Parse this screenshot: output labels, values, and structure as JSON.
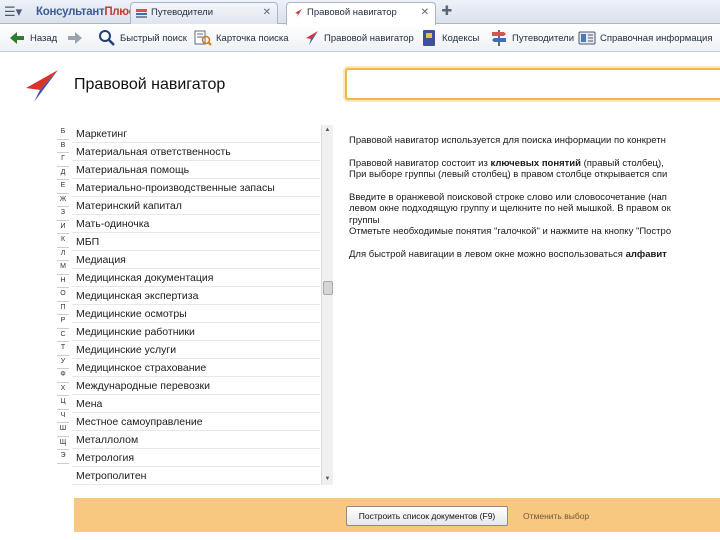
{
  "app": {
    "logo_main": "Консультант",
    "logo_accent": "Плюс"
  },
  "tabs": [
    {
      "label": "Путеводители"
    },
    {
      "label": "Правовой навигатор"
    }
  ],
  "toolbar": {
    "back": "Назад",
    "quick_search": "Быстрый поиск",
    "search_card": "Карточка поиска",
    "legal_navigator": "Правовой навигатор",
    "codes": "Кодексы",
    "guides": "Путеводители",
    "reference": "Справочная информация"
  },
  "page": {
    "title": "Правовой навигатор",
    "search_value": ""
  },
  "alphabet": [
    "Б",
    "В",
    "Г",
    "Д",
    "Е",
    "Ж",
    "З",
    "И",
    "К",
    "Л",
    "М",
    "Н",
    "О",
    "П",
    "Р",
    "С",
    "Т",
    "У",
    "Ф",
    "Х",
    "Ц",
    "Ч",
    "Ш",
    "Щ",
    "Э"
  ],
  "concepts": [
    "Маркетинг",
    "Материальная ответственность",
    "Материальная помощь",
    "Материально-производственные запасы",
    "Материнский капитал",
    "Мать-одиночка",
    "МБП",
    "Медиация",
    "Медицинская документация",
    "Медицинская экспертиза",
    "Медицинские осмотры",
    "Медицинские работники",
    "Медицинские услуги",
    "Медицинское страхование",
    "Международные перевозки",
    "Мена",
    "Местное самоуправление",
    "Металлолом",
    "Метрология",
    "Метрополитен"
  ],
  "info": {
    "p1": "Правовой навигатор используется для поиска информации по конкретн",
    "p2_l1_pre": "Правовой навигатор состоит из ",
    "p2_l1_bold": "ключевых понятий",
    "p2_l1_post": " (правый столбец),",
    "p2_l2": "При выборе группы (левый столбец) в правом столбце открывается спи",
    "p3_l1": "Введите в оранжевой поисковой строке слово или словосочетание (нап",
    "p3_l2": "левом окне подходящую группу и щелкните по ней мышкой. В правом ок",
    "p3_l3": "группы",
    "p3_l4": "Отметьте необходимые понятия \"галочкой\" и нажмите на кнопку \"Постро",
    "p4_pre": "Для быстрой навигации в левом окне можно воспользоваться ",
    "p4_bold": "алфавит"
  },
  "bottom": {
    "build_button": "Построить список документов (F9)",
    "cancel_link": "Отменить выбор"
  },
  "colors": {
    "accent_orange": "#f1b74a",
    "bottom_bar": "#f8c880",
    "nav_red": "#d8342c",
    "nav_blue": "#3b4fa8"
  }
}
